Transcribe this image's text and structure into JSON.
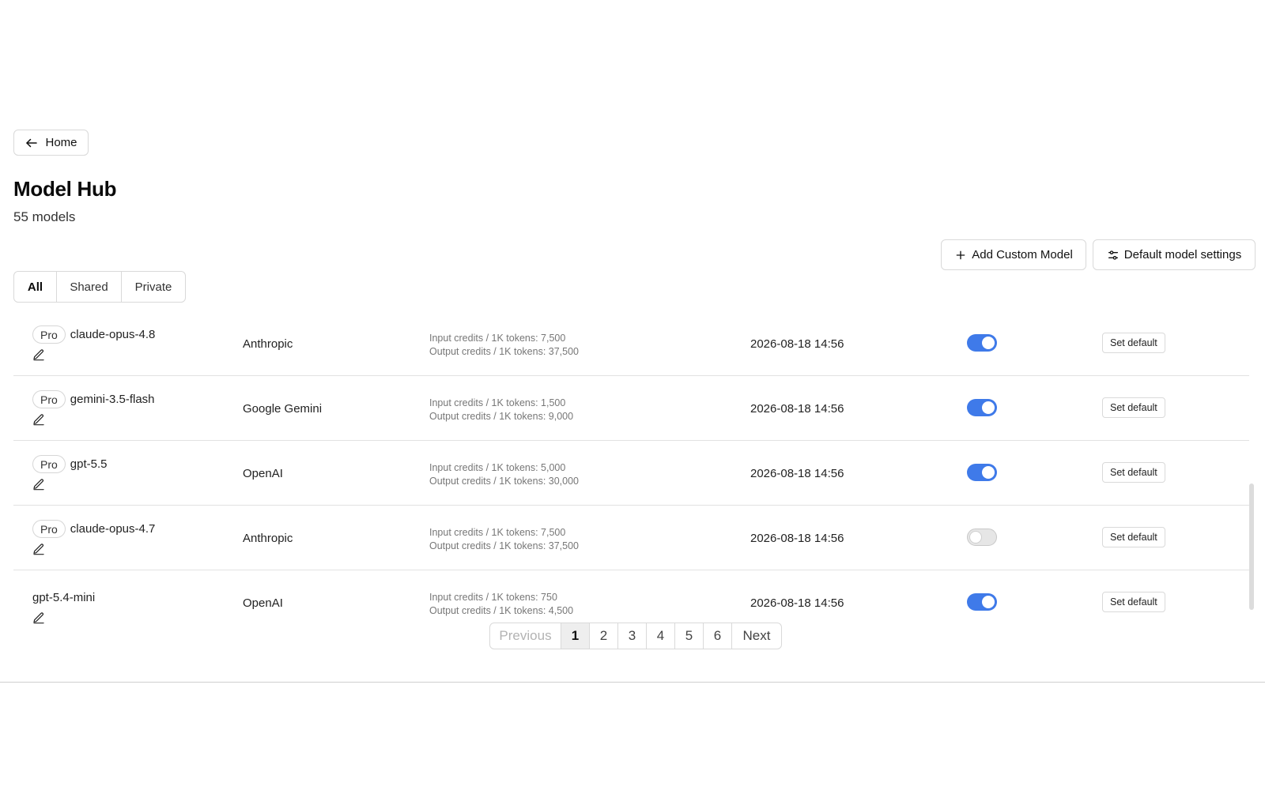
{
  "nav": {
    "home_label": "Home"
  },
  "header": {
    "title": "Model Hub",
    "subtitle": "55 models"
  },
  "actions": {
    "add_custom_model": "Add Custom Model",
    "default_model_settings": "Default model settings"
  },
  "tabs": [
    {
      "label": "All",
      "active": true
    },
    {
      "label": "Shared",
      "active": false
    },
    {
      "label": "Private",
      "active": false
    }
  ],
  "models": [
    {
      "badge": "Pro",
      "name": "claude-opus-4.8",
      "provider": "Anthropic",
      "input_credits": "Input credits / 1K tokens: 7,500",
      "output_credits": "Output credits / 1K tokens: 37,500",
      "created": "2026-08-18 14:56",
      "enabled": true,
      "action": "Set default"
    },
    {
      "badge": "Pro",
      "name": "gemini-3.5-flash",
      "provider": "Google Gemini",
      "input_credits": "Input credits / 1K tokens: 1,500",
      "output_credits": "Output credits / 1K tokens: 9,000",
      "created": "2026-08-18 14:56",
      "enabled": true,
      "action": "Set default"
    },
    {
      "badge": "Pro",
      "name": "gpt-5.5",
      "provider": "OpenAI",
      "input_credits": "Input credits / 1K tokens: 5,000",
      "output_credits": "Output credits / 1K tokens: 30,000",
      "created": "2026-08-18 14:56",
      "enabled": true,
      "action": "Set default"
    },
    {
      "badge": "Pro",
      "name": "claude-opus-4.7",
      "provider": "Anthropic",
      "input_credits": "Input credits / 1K tokens: 7,500",
      "output_credits": "Output credits / 1K tokens: 37,500",
      "created": "2026-08-18 14:56",
      "enabled": false,
      "action": "Set default"
    },
    {
      "badge": "",
      "name": "gpt-5.4-mini",
      "provider": "OpenAI",
      "input_credits": "Input credits / 1K tokens: 750",
      "output_credits": "Output credits / 1K tokens: 4,500",
      "created": "2026-08-18 14:56",
      "enabled": true,
      "action": "Set default"
    }
  ],
  "pagination": {
    "previous": "Previous",
    "pages": [
      "1",
      "2",
      "3",
      "4",
      "5",
      "6"
    ],
    "current": "1",
    "next": "Next"
  },
  "colors": {
    "toggle_on": "#3f7ae9",
    "toggle_off": "#e6e6e6"
  }
}
